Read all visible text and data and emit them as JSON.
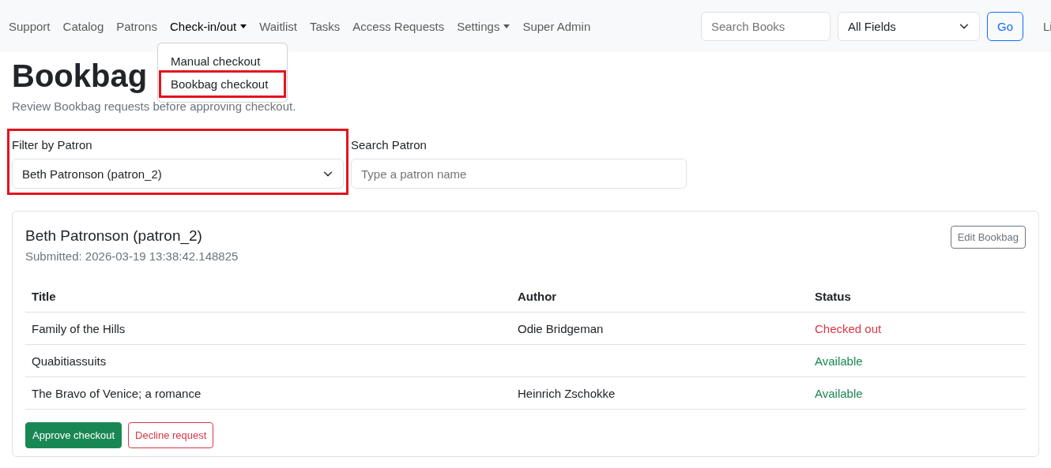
{
  "navbar": {
    "items": [
      {
        "label": "Support",
        "selected": false,
        "dropdown": false
      },
      {
        "label": "Catalog",
        "selected": false,
        "dropdown": false
      },
      {
        "label": "Patrons",
        "selected": false,
        "dropdown": false
      },
      {
        "label": "Check-in/out",
        "selected": true,
        "dropdown": true
      },
      {
        "label": "Waitlist",
        "selected": false,
        "dropdown": false
      },
      {
        "label": "Tasks",
        "selected": false,
        "dropdown": false
      },
      {
        "label": "Access Requests",
        "selected": false,
        "dropdown": false
      },
      {
        "label": "Settings",
        "selected": false,
        "dropdown": true
      },
      {
        "label": "Super Admin",
        "selected": false,
        "dropdown": false
      }
    ],
    "search": {
      "placeholder": "Search Books"
    },
    "field_select": {
      "value": "All Fields"
    },
    "go_button": "Go",
    "right_link": "Li"
  },
  "dropdown_menu": {
    "items": [
      {
        "label": "Manual checkout",
        "highlighted": false
      },
      {
        "label": "Bookbag checkout",
        "highlighted": true
      }
    ]
  },
  "page": {
    "title": "Bookbag",
    "subtitle": "Review Bookbag requests before approving checkout."
  },
  "filter": {
    "label": "Filter by Patron",
    "value": "Beth Patronson (patron_2)",
    "highlighted": true
  },
  "patron_search": {
    "label": "Search Patron",
    "placeholder": "Type a patron name"
  },
  "card": {
    "title": "Beth Patronson (patron_2)",
    "submitted": "Submitted: 2026-03-19 13:38:42.148825",
    "edit_button": "Edit Bookbag",
    "table": {
      "columns": [
        "Title",
        "Author",
        "Status"
      ],
      "rows": [
        {
          "title": "Family of the Hills",
          "author": "Odie Bridgeman",
          "status": "Checked out",
          "kind": "checked_out"
        },
        {
          "title": "Quabitiassuits",
          "author": "",
          "status": "Available",
          "kind": "available"
        },
        {
          "title": "The Bravo of Venice; a romance",
          "author": "Heinrich Zschokke",
          "status": "Available",
          "kind": "available"
        }
      ]
    },
    "approve_button": "Approve checkout",
    "decline_button": "Decline request"
  }
}
